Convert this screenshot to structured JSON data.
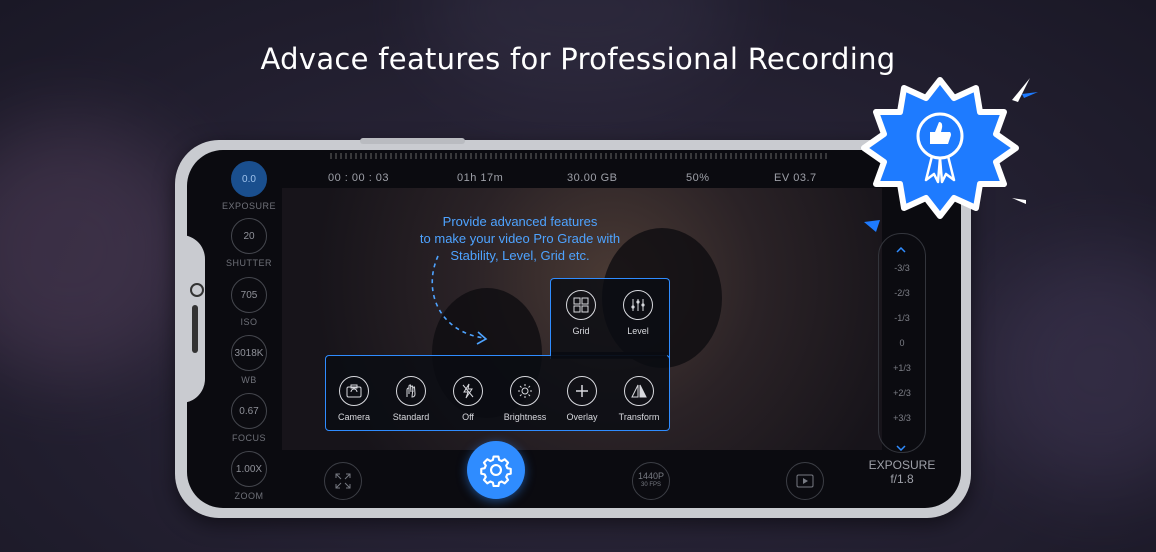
{
  "headline": "Advace features for Professional Recording",
  "status_bar": {
    "timer": "00 : 00 : 03",
    "remaining_time": "01h 17m",
    "storage": "30.00 GB",
    "battery": "50%",
    "ev": "EV 03.7"
  },
  "left_controls": [
    {
      "value": "0.0",
      "label": "EXPOSURE"
    },
    {
      "value": "20",
      "label": "SHUTTER"
    },
    {
      "value": "705",
      "label": "ISO"
    },
    {
      "value": "3018K",
      "label": "WB"
    },
    {
      "value": "0.67",
      "label": "FOCUS"
    },
    {
      "value": "1.00X",
      "label": "ZOOM"
    }
  ],
  "callout": {
    "line1": "Provide advanced features",
    "line2": "to make your video Pro Grade with",
    "line3": "Stability, Level, Grid etc."
  },
  "features_top": [
    {
      "label": "Grid",
      "icon": "grid-icon"
    },
    {
      "label": "Level",
      "icon": "level-icon"
    }
  ],
  "features_bottom": [
    {
      "label": "Camera",
      "icon": "camera-switch-icon"
    },
    {
      "label": "Standard",
      "icon": "stabilization-icon"
    },
    {
      "label": "Off",
      "icon": "flash-off-icon"
    },
    {
      "label": "Brightness",
      "icon": "brightness-icon"
    },
    {
      "label": "Overlay",
      "icon": "plus-icon"
    },
    {
      "label": "Transform",
      "icon": "transform-icon"
    }
  ],
  "exposure_scale": {
    "ticks": [
      "-3/3",
      "-2/3",
      "-1/3",
      "0",
      "+1/3",
      "+2/3",
      "+3/3"
    ],
    "caption": "EXPOSURE",
    "aperture": "f/1.8"
  },
  "bottom_bar": {
    "resolution": "1440P",
    "fps": "30 FPS"
  },
  "colors": {
    "accent": "#2f8cff",
    "badge": "#1e7bff"
  }
}
